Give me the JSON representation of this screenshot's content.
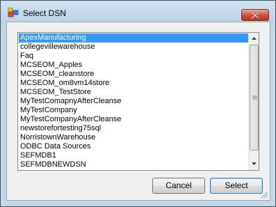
{
  "window": {
    "title": "Select DSN",
    "close_icon": "close-icon"
  },
  "dsn_list": {
    "selected_index": 0,
    "items": [
      "ApexManufacturing",
      "collegevillewarehouse",
      "Faq",
      "MCSEOM_Apples",
      "MCSEOM_cleanstore",
      "MCSEOM_om8vm14store",
      "MCSEOM_TestStore",
      "MyTestComapnyAfterCleanse",
      "MyTestCompany",
      "MyTestCompanyAfterCleanse",
      "newstorefortesting75sql",
      "NorristownWarehouse",
      "ODBC Data Sources",
      "SEFMDB1",
      "SEFMDBNEWDSN"
    ]
  },
  "buttons": {
    "cancel_label": "Cancel",
    "select_label": "Select"
  },
  "colors": {
    "selection": "#3399ff",
    "titlebar": "#bfd8ea",
    "close_button": "#c9503a"
  }
}
